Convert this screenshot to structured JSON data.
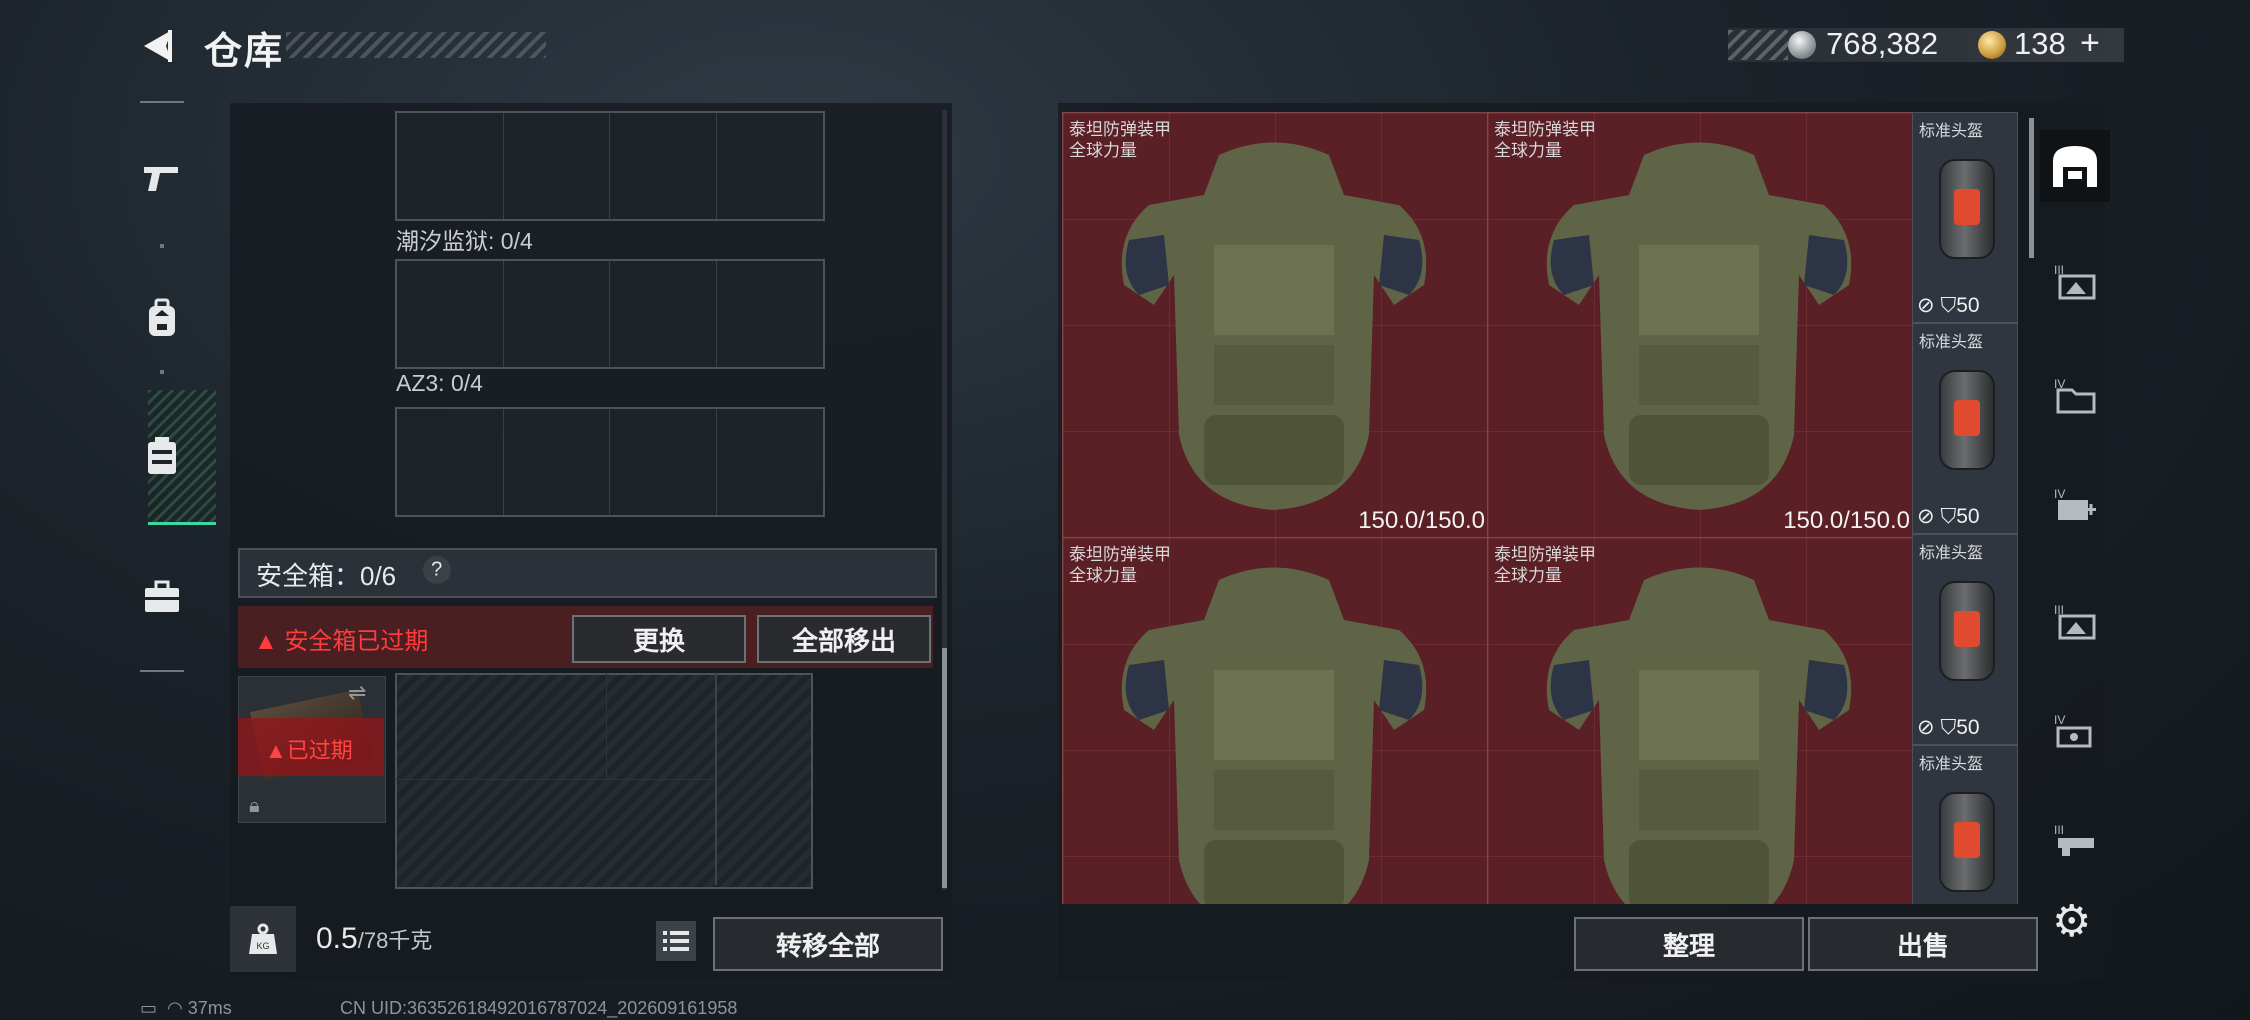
{
  "header": {
    "title": "仓库"
  },
  "currency": {
    "silver": "768,382",
    "gold": "138",
    "plus": "+"
  },
  "left": {
    "sections": [
      {
        "label": "潮汐监狱: 0/4"
      },
      {
        "label": "AZ3: 0/4"
      }
    ],
    "safebox": {
      "label": "安全箱：0/6",
      "help": "?"
    },
    "expired_warning": "安全箱已过期",
    "replace_label": "更换",
    "move_all_label": "全部移出",
    "case_status": "已过期",
    "weight": {
      "current": "0.5",
      "max": "/78千克"
    },
    "transfer_all_label": "转移全部"
  },
  "armor": {
    "name_line1": "泰坦防弹装甲",
    "name_line2": "全球力量",
    "durability": "150.0/150.0"
  },
  "helmet": {
    "name": "标准头盔",
    "armor_value": "50"
  },
  "right": {
    "sort_label": "整理",
    "sell_label": "出售"
  },
  "status": {
    "ping": "37ms",
    "uid": "CN UID:3635261849201678​7024_202609161958"
  },
  "colors": {
    "accent": "#3fd6a0",
    "warning": "#ff3b3b",
    "armor_bg": "#5b1f26"
  }
}
